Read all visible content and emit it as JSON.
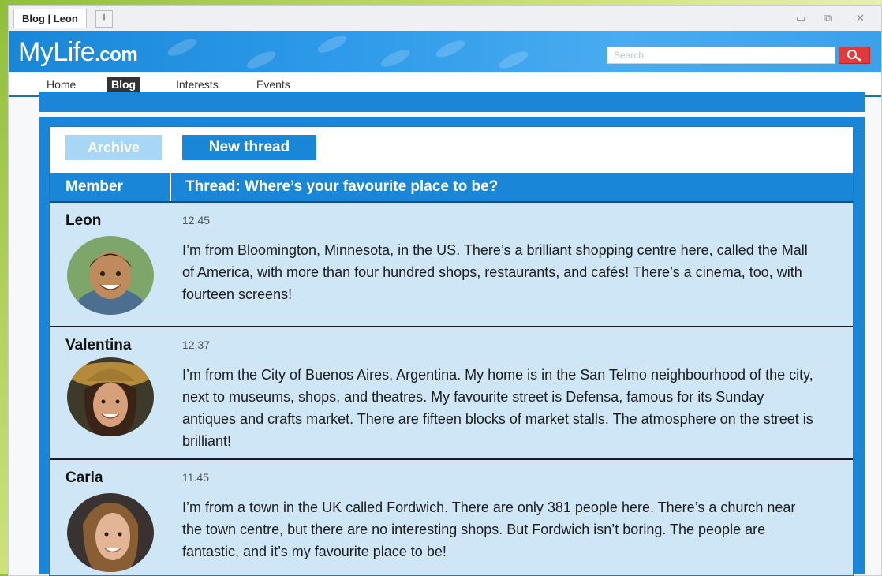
{
  "browser": {
    "tab_title": "Blog | Leon",
    "new_tab_label": "+",
    "controls": {
      "minimize": "▭",
      "maximize": "⧉",
      "close": "✕"
    }
  },
  "header": {
    "logo_main": "MyLife",
    "logo_suffix": ".com",
    "search_placeholder": "Search",
    "search_icon": "search-icon"
  },
  "nav": {
    "items": [
      {
        "label": "Home",
        "active": false
      },
      {
        "label": "Blog",
        "active": true
      },
      {
        "label": "Interests",
        "active": false
      },
      {
        "label": "Events",
        "active": false
      }
    ]
  },
  "toolbar": {
    "archive_label": "Archive",
    "new_thread_label": "New thread"
  },
  "table": {
    "col_member": "Member",
    "col_thread": "Thread: Where’s your favourite place to be?"
  },
  "posts": [
    {
      "name": "Leon",
      "time": "12.45",
      "text": "I’m from Bloomington, Minnesota, in the US. There’s a brilliant shopping centre here, called the Mall of America, with more than four hundred shops, restaurants, and cafés! There’s a cinema, too, with fourteen screens!"
    },
    {
      "name": "Valentina",
      "time": "12.37",
      "text": "I’m from the City of Buenos Aires, Argentina. My home is in the San Telmo neighbourhood of the city, next to museums, shops, and theatres. My favourite street is Defensa, famous for its Sunday antiques and crafts market. There are fifteen blocks of market stalls. The atmosphere on the street is brilliant!"
    },
    {
      "name": "Carla",
      "time": "11.45",
      "text": "I’m from a town in the UK called Fordwich. There are only 381 people here. There’s a church near the town centre, but there are no interesting shops. But Fordwich isn’t boring. The people are fantastic, and it’s my favourite place to be!"
    }
  ],
  "colors": {
    "brand_blue": "#1a86d8",
    "post_bg": "#cfe6f7",
    "search_button": "#e23a3a"
  }
}
